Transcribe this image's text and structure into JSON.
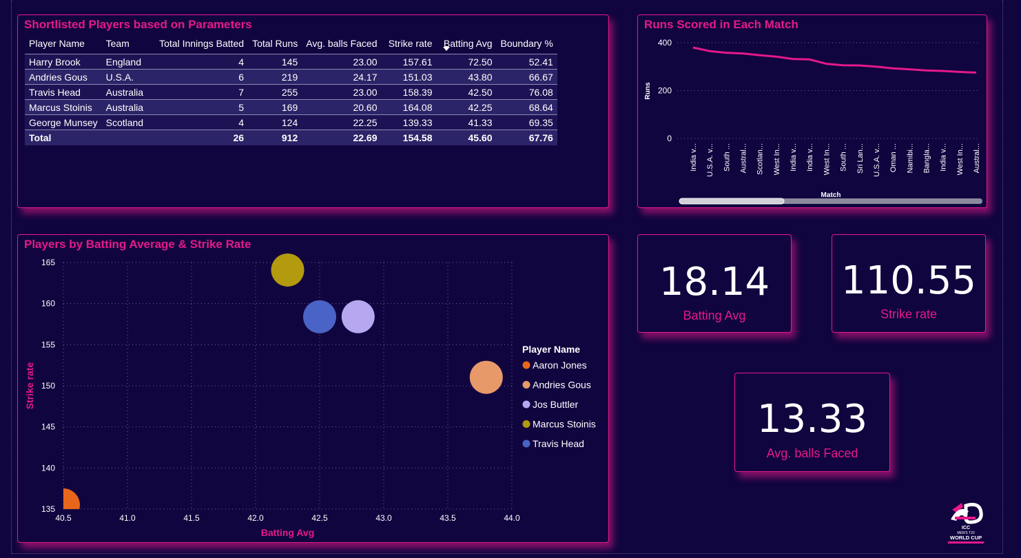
{
  "table": {
    "title": "Shortlisted Players based on Parameters",
    "columns": [
      "Player Name",
      "Team",
      "Total Innings Batted",
      "Total Runs",
      "Avg. balls Faced",
      "Strike rate",
      "Batting Avg",
      "Boundary %"
    ],
    "rows": [
      [
        "Harry Brook",
        "England",
        "4",
        "145",
        "23.00",
        "157.61",
        "72.50",
        "52.41"
      ],
      [
        "Andries Gous",
        "U.S.A.",
        "6",
        "219",
        "24.17",
        "151.03",
        "43.80",
        "66.67"
      ],
      [
        "Travis Head",
        "Australia",
        "7",
        "255",
        "23.00",
        "158.39",
        "42.50",
        "76.08"
      ],
      [
        "Marcus Stoinis",
        "Australia",
        "5",
        "169",
        "20.60",
        "164.08",
        "42.25",
        "68.64"
      ],
      [
        "George Munsey",
        "Scotland",
        "4",
        "124",
        "22.25",
        "139.33",
        "41.33",
        "69.35"
      ]
    ],
    "total": [
      "Total",
      "",
      "26",
      "912",
      "22.69",
      "154.58",
      "45.60",
      "67.76"
    ]
  },
  "line_card": {
    "title": "Runs Scored in Each Match"
  },
  "scatter_card": {
    "title": "Players by Batting Average & Strike Rate"
  },
  "kpis": {
    "batting_avg": {
      "value": "18.14",
      "label": "Batting Avg"
    },
    "strike_rate": {
      "value": "110.55",
      "label": "Strike rate"
    },
    "balls_faced": {
      "value": "13.33",
      "label": "Avg. balls Faced"
    }
  },
  "logo": {
    "text": "ICC MEN'S T20 WORLD CUP"
  },
  "colors": {
    "accent": "#e5198a",
    "background": "#11053f"
  },
  "chart_data": [
    {
      "type": "line",
      "title": "Runs Scored in Each Match",
      "xlabel": "Match",
      "ylabel": "Runs",
      "ylim": [
        0,
        400
      ],
      "yticks": [
        0,
        200,
        400
      ],
      "categories": [
        "India v...",
        "U.S.A. v...",
        "South ...",
        "Austral...",
        "Scotlan...",
        "West In...",
        "India v...",
        "India v...",
        "West In...",
        "South ...",
        "Sri Lan...",
        "U.S.A. v...",
        "Oman ...",
        "Namibi...",
        "Bangla...",
        "India v...",
        "West In...",
        "Austral..."
      ],
      "values": [
        380,
        365,
        358,
        355,
        348,
        342,
        332,
        330,
        312,
        306,
        305,
        300,
        293,
        289,
        284,
        282,
        278,
        275
      ],
      "grid": true,
      "scrollbar": true
    },
    {
      "type": "scatter",
      "title": "Players by Batting Average & Strike Rate",
      "xlabel": "Batting Avg",
      "ylabel": "Strike rate",
      "xlim": [
        40.5,
        44.0
      ],
      "ylim": [
        135,
        165
      ],
      "xticks": [
        "40.5",
        "41.0",
        "41.5",
        "42.0",
        "42.5",
        "43.0",
        "43.5",
        "44.0"
      ],
      "yticks": [
        "135",
        "140",
        "145",
        "150",
        "155",
        "160",
        "165"
      ],
      "legend_title": "Player Name",
      "legend_position": "right",
      "series": [
        {
          "name": "Aaron Jones",
          "color": "#e8661b",
          "x": 40.5,
          "y": 135.5
        },
        {
          "name": "Andries Gous",
          "color": "#e8996a",
          "x": 43.8,
          "y": 151.03
        },
        {
          "name": "Jos Buttler",
          "color": "#b7a7f1",
          "x": 42.8,
          "y": 158.4
        },
        {
          "name": "Marcus Stoinis",
          "color": "#b39a0e",
          "x": 42.25,
          "y": 164.08
        },
        {
          "name": "Travis Head",
          "color": "#4a63c6",
          "x": 42.5,
          "y": 158.39
        }
      ]
    }
  ]
}
